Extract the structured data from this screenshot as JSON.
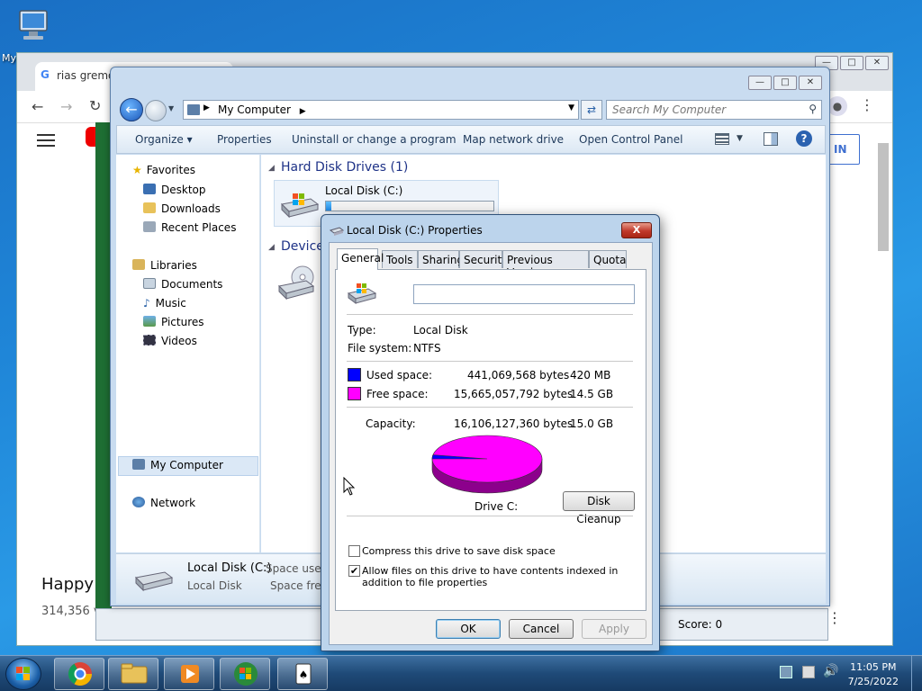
{
  "desktop": {
    "icon_label": "My"
  },
  "browser": {
    "tab_title": "rias gremo",
    "sign_in_label": "IN",
    "video_title_fragment": "Happy",
    "video_views_fragment": "314,356 v",
    "score_label": "Score: 0",
    "more_label": "⋮"
  },
  "explorer": {
    "address": "My Computer",
    "search_placeholder": "Search My Computer",
    "commands": [
      "Organize",
      "Properties",
      "Uninstall or change a program",
      "Map network drive",
      "Open Control Panel"
    ],
    "nav": {
      "favorites": "Favorites",
      "favorites_items": [
        "Desktop",
        "Downloads",
        "Recent Places"
      ],
      "libraries": "Libraries",
      "libraries_items": [
        "Documents",
        "Music",
        "Pictures",
        "Videos"
      ],
      "computer": "My Computer",
      "network": "Network"
    },
    "sections": {
      "hdd": "Hard Disk Drives (1)",
      "devices": "Device"
    },
    "drive_label": "Local Disk (C:)",
    "drive_used_fraction": 0.03,
    "details": {
      "name": "Local Disk (C:)",
      "type": "Local Disk",
      "space_used_label": "Space used:",
      "space_free_label": "Space free:"
    }
  },
  "dialog": {
    "title": "Local Disk (C:) Properties",
    "close_label": "X",
    "tabs": [
      "General",
      "Tools",
      "Sharing",
      "Security",
      "Previous Versions",
      "Quota"
    ],
    "name_value": "",
    "type_label": "Type:",
    "type_value": "Local Disk",
    "fs_label": "File system:",
    "fs_value": "NTFS",
    "used_label": "Used space:",
    "used_bytes": "441,069,568 bytes",
    "used_size": "420 MB",
    "free_label": "Free space:",
    "free_bytes": "15,665,057,792 bytes",
    "free_size": "14.5 GB",
    "capacity_label": "Capacity:",
    "capacity_bytes": "16,106,127,360 bytes",
    "capacity_size": "15.0 GB",
    "drive_caption": "Drive C:",
    "disk_cleanup_label": "Disk Cleanup",
    "compress_label": "Compress this drive to save disk space",
    "compress_checked": false,
    "index_label": "Allow files on this drive to have contents indexed in addition to file properties",
    "index_checked": true,
    "ok_label": "OK",
    "cancel_label": "Cancel",
    "apply_label": "Apply",
    "used_color": "#0000ff",
    "free_color": "#ff00ff",
    "used_fraction": 0.0274
  },
  "taskbar": {
    "time": "11:05 PM",
    "date": "7/25/2022"
  }
}
